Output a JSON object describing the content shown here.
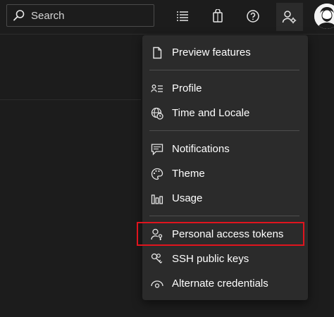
{
  "search": {
    "placeholder": "Search"
  },
  "toolbar": {
    "icons": [
      "list-icon",
      "shopping-bag-icon",
      "help-icon",
      "user-settings-icon",
      "avatar"
    ]
  },
  "menu": {
    "items": [
      {
        "label": "Preview features",
        "icon": "document-icon"
      },
      {
        "label": "Profile",
        "icon": "profile-card-icon"
      },
      {
        "label": "Time and Locale",
        "icon": "globe-clock-icon"
      },
      {
        "label": "Notifications",
        "icon": "comment-icon"
      },
      {
        "label": "Theme",
        "icon": "palette-icon"
      },
      {
        "label": "Usage",
        "icon": "bar-chart-icon"
      },
      {
        "label": "Personal access tokens",
        "icon": "person-key-icon",
        "highlighted": true
      },
      {
        "label": "SSH public keys",
        "icon": "key-icon"
      },
      {
        "label": "Alternate credentials",
        "icon": "eye-icon"
      }
    ]
  },
  "colors": {
    "background": "#1c1c1c",
    "menu_background": "#2b2b2b",
    "highlight": "#e0141e",
    "text": "#ffffff"
  }
}
